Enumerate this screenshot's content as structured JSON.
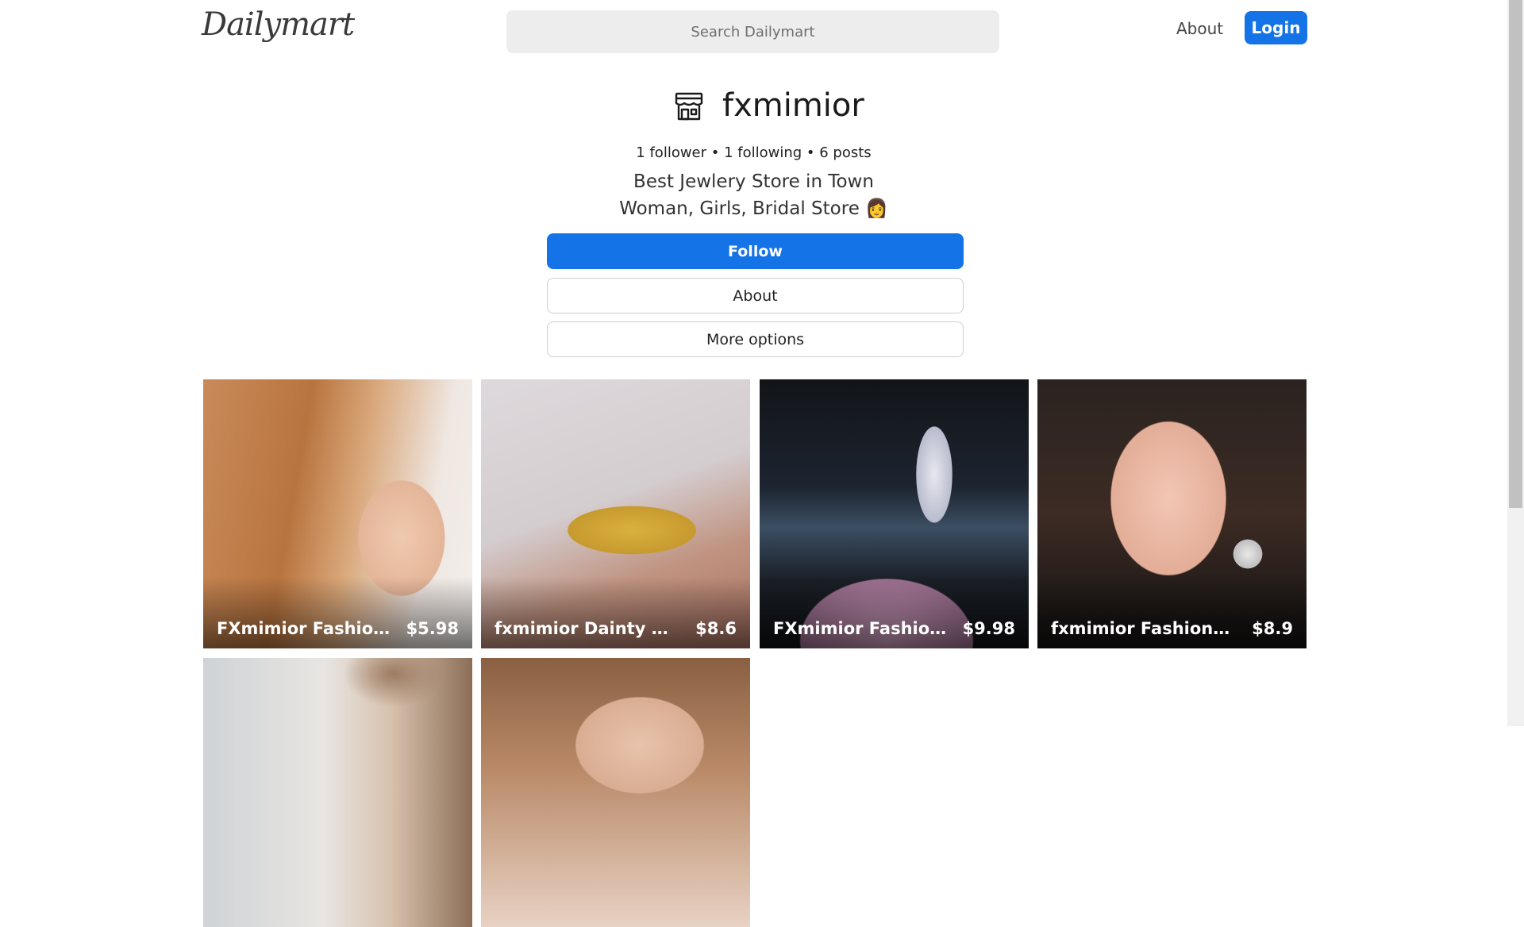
{
  "header": {
    "logo_text": "Dailymart",
    "search_placeholder": "Search Dailymart",
    "about_label": "About",
    "login_label": "Login"
  },
  "profile": {
    "store_icon": "storefront-icon",
    "name": "fxmimior",
    "stats": "1 follower • 1 following • 6 posts",
    "bio_line1": "Best Jewlery Store in Town",
    "bio_line2": "Woman, Girls, Bridal Store 👩",
    "follow_label": "Follow",
    "about_label": "About",
    "more_options_label": "More options"
  },
  "posts": [
    {
      "title": "FXmimior Fashion W...",
      "price": "$5.98"
    },
    {
      "title": "fxmimior Dainty Boho ...",
      "price": "$8.6"
    },
    {
      "title": "FXmimior Fashion W...",
      "price": "$9.98"
    },
    {
      "title": "fxmimior Fashion Wo...",
      "price": "$8.9"
    },
    {
      "title": "",
      "price": ""
    },
    {
      "title": "",
      "price": ""
    }
  ],
  "colors": {
    "accent": "#1473e6",
    "search_bg": "#ededed"
  }
}
